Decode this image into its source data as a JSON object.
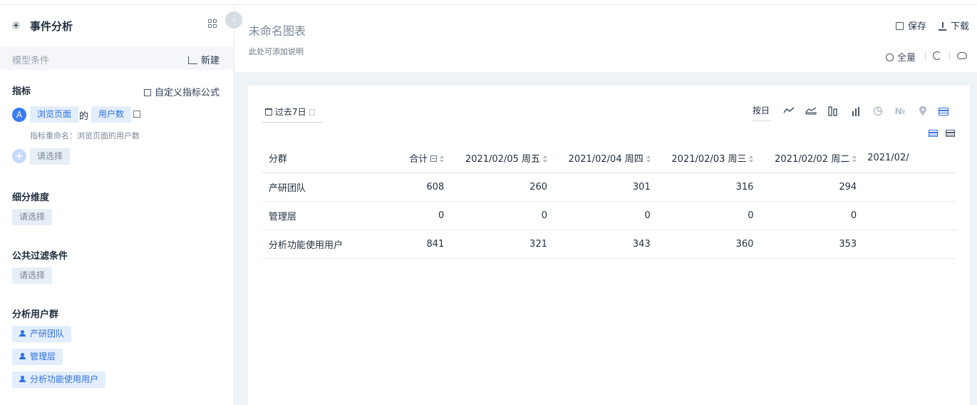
{
  "sidebar": {
    "title": "事件分析",
    "model_label": "模型条件",
    "new_label": "新建",
    "sections": {
      "metrics": "指标",
      "breakdown": "细分维度",
      "filters": "公共过滤条件",
      "user_groups": "分析用户群"
    },
    "custom_formula": "自定义指标公式",
    "metric": {
      "letter": "A",
      "event": "浏览页面",
      "connector": "的",
      "measure": "用户数",
      "rename": "指标重命名：浏览页面的用户数"
    },
    "select_placeholder": "请选择",
    "groups": [
      "产研团队",
      "管理层",
      "分析功能使用用户"
    ]
  },
  "header": {
    "chart_title": "未命名图表",
    "description": "此处可添加说明",
    "save_label": "保存",
    "download_label": "下载",
    "search_label": "全量"
  },
  "toolbar": {
    "date_range": "过去7日",
    "granularity": "按日",
    "chart_types": [
      "line-chart-icon",
      "area-chart-icon",
      "funnel-icon",
      "bar-chart-icon",
      "pie-chart-icon",
      "number-icon",
      "map-pin-icon",
      "table-icon"
    ],
    "number_glyph": "№"
  },
  "table": {
    "headers": [
      "分群",
      "合计",
      "2021/02/05 周五",
      "2021/02/04 周四",
      "2021/02/03 周三",
      "2021/02/02 周二",
      "2021/02/"
    ],
    "rows": [
      {
        "group": "产研团队",
        "values": [
          "608",
          "260",
          "301",
          "316",
          "294"
        ]
      },
      {
        "group": "管理层",
        "values": [
          "0",
          "0",
          "0",
          "0",
          "0"
        ]
      },
      {
        "group": "分析功能使用用户",
        "values": [
          "841",
          "321",
          "343",
          "360",
          "353"
        ]
      }
    ]
  },
  "colors": {
    "accent": "#2f6fe0",
    "tag_bg": "#e3eefc",
    "main_bg": "#eef3f8"
  }
}
